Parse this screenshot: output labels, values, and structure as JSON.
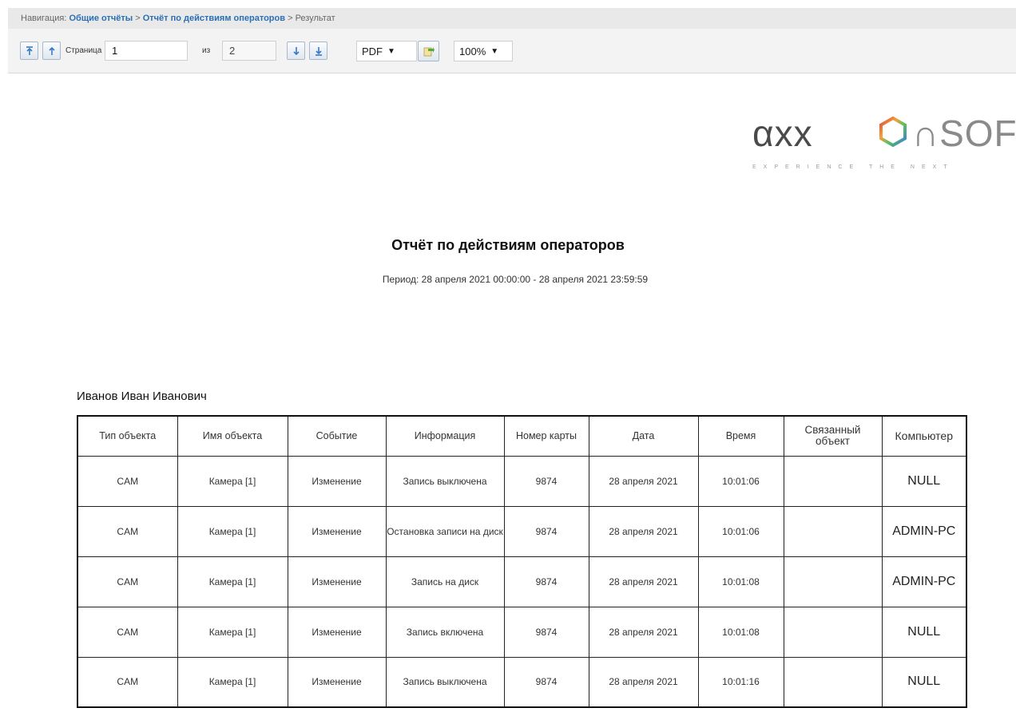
{
  "nav": {
    "prefix": "Навигация:",
    "crumbs": [
      "Общие отчёты",
      "Отчёт по действиям операторов"
    ],
    "current": "Результат",
    "separator": ">"
  },
  "toolbar": {
    "page_label": "Страница",
    "page_value": "1",
    "of_label": "из",
    "total_pages": "2",
    "format_value": "PDF",
    "zoom_value": "100%",
    "icons": [
      "first-page-icon",
      "previous-page-icon",
      "next-page-icon",
      "last-page-icon",
      "export-icon"
    ]
  },
  "logo": {
    "left": "αxx",
    "right": "∩SOFT",
    "tagline": "EXPERIENCE THE NEXT"
  },
  "report": {
    "title": "Отчёт по действиям операторов",
    "period": "Период: 28 апреля 2021 00:00:00 - 28 апреля 2021 23:59:59",
    "operator": "Иванов Иван Иванович",
    "columns": [
      "Тип объекта",
      "Имя объекта",
      "Событие",
      "Информация",
      "Номер карты",
      "Дата",
      "Время",
      "Связанный объект",
      "Компьютер"
    ],
    "rows": [
      [
        "CAM",
        "Камера [1]",
        "Изменение",
        "Запись выключена",
        "9874",
        "28 апреля 2021",
        "10:01:06",
        "",
        "NULL"
      ],
      [
        "CAM",
        "Камера [1]",
        "Изменение",
        "Остановка записи на диск",
        "9874",
        "28 апреля 2021",
        "10:01:06",
        "",
        "ADMIN-PC"
      ],
      [
        "CAM",
        "Камера [1]",
        "Изменение",
        "Запись на диск",
        "9874",
        "28 апреля 2021",
        "10:01:08",
        "",
        "ADMIN-PC"
      ],
      [
        "CAM",
        "Камера [1]",
        "Изменение",
        "Запись включена",
        "9874",
        "28 апреля 2021",
        "10:01:08",
        "",
        "NULL"
      ],
      [
        "CAM",
        "Камера [1]",
        "Изменение",
        "Запись выключена",
        "9874",
        "28 апреля 2021",
        "10:01:16",
        "",
        "NULL"
      ]
    ]
  }
}
